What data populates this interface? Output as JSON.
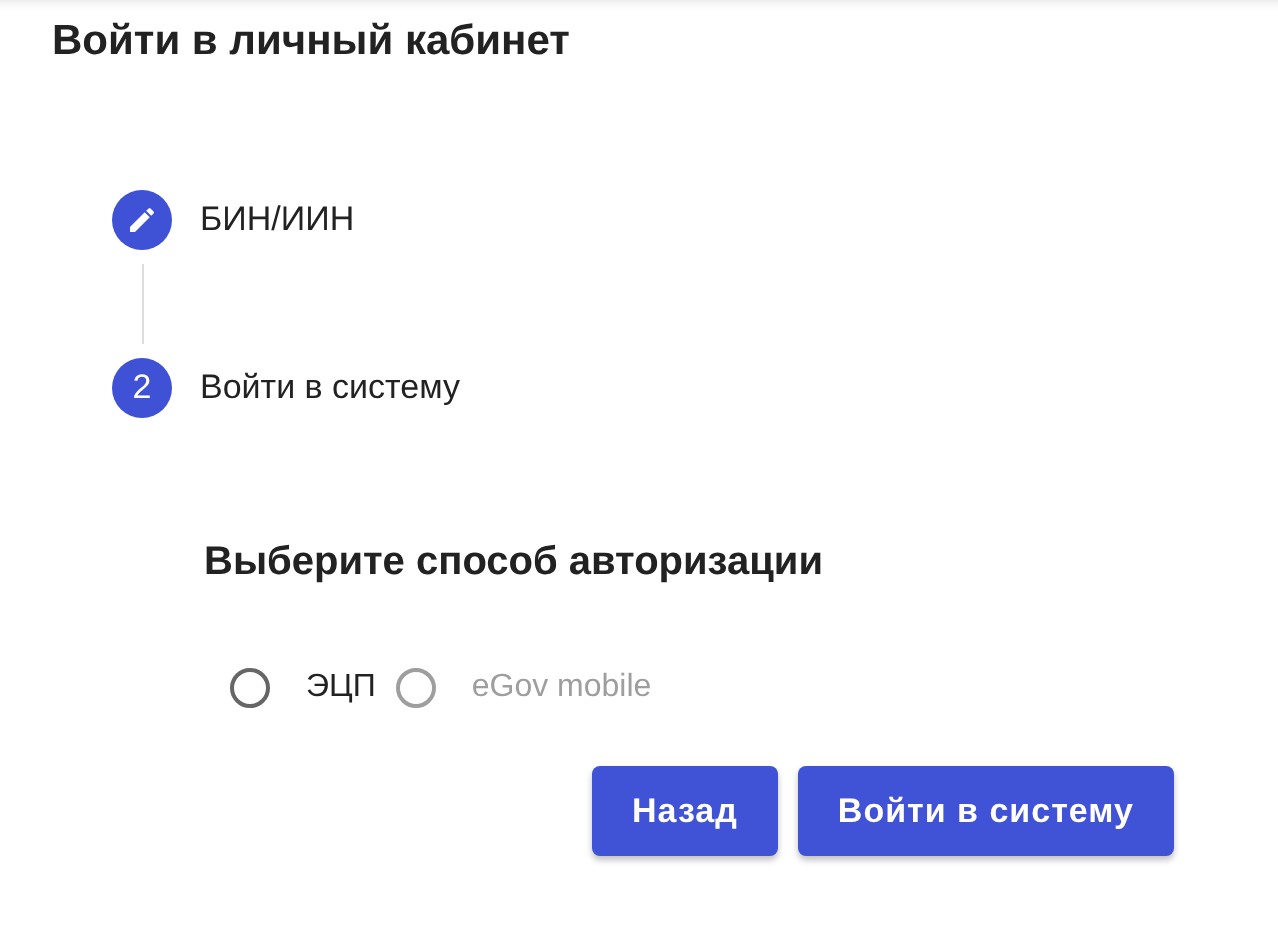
{
  "title": "Войти в личный кабинет",
  "steps": [
    {
      "kind": "edit",
      "label": "БИН/ИИН"
    },
    {
      "kind": "number",
      "number": "2",
      "label": "Войти в систему"
    }
  ],
  "auth": {
    "heading": "Выберите способ авторизации",
    "options": [
      {
        "label": "ЭЦП",
        "selected": false,
        "disabled": false
      },
      {
        "label": "eGov mobile",
        "selected": false,
        "disabled": true
      }
    ]
  },
  "buttons": [
    "Назад",
    "Войти в систему"
  ]
}
